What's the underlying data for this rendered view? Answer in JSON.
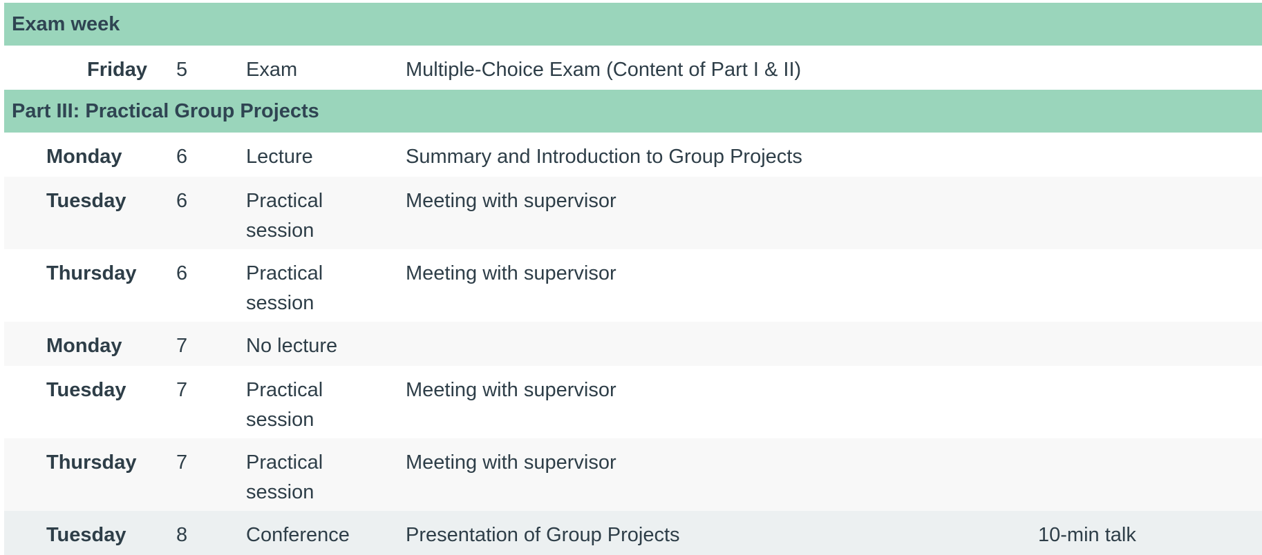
{
  "sections": {
    "exam_week": {
      "title": "Exam week",
      "rows": [
        {
          "day": "Friday",
          "week": "5",
          "type": "Exam",
          "description": "Multiple-Choice Exam (Content of Part I & II)",
          "note": ""
        }
      ]
    },
    "part3": {
      "title": "Part III: Practical Group Projects",
      "rows": [
        {
          "day": "Monday",
          "week": "6",
          "type": "Lecture",
          "description": "Summary and Introduction to Group Projects",
          "note": ""
        },
        {
          "day": "Tuesday",
          "week": "6",
          "type": "Practical session",
          "description": "Meeting with supervisor",
          "note": ""
        },
        {
          "day": "Thursday",
          "week": "6",
          "type": "Practical session",
          "description": "Meeting with supervisor",
          "note": ""
        },
        {
          "day": "Monday",
          "week": "7",
          "type": "No lecture",
          "description": "",
          "note": ""
        },
        {
          "day": "Tuesday",
          "week": "7",
          "type": "Practical session",
          "description": "Meeting with supervisor",
          "note": ""
        },
        {
          "day": "Thursday",
          "week": "7",
          "type": "Practical session",
          "description": "Meeting with supervisor",
          "note": ""
        },
        {
          "day": "Tuesday",
          "week": "8",
          "type": "Conference",
          "description": "Presentation of Group Projects",
          "note": "10-min talk"
        }
      ]
    }
  }
}
